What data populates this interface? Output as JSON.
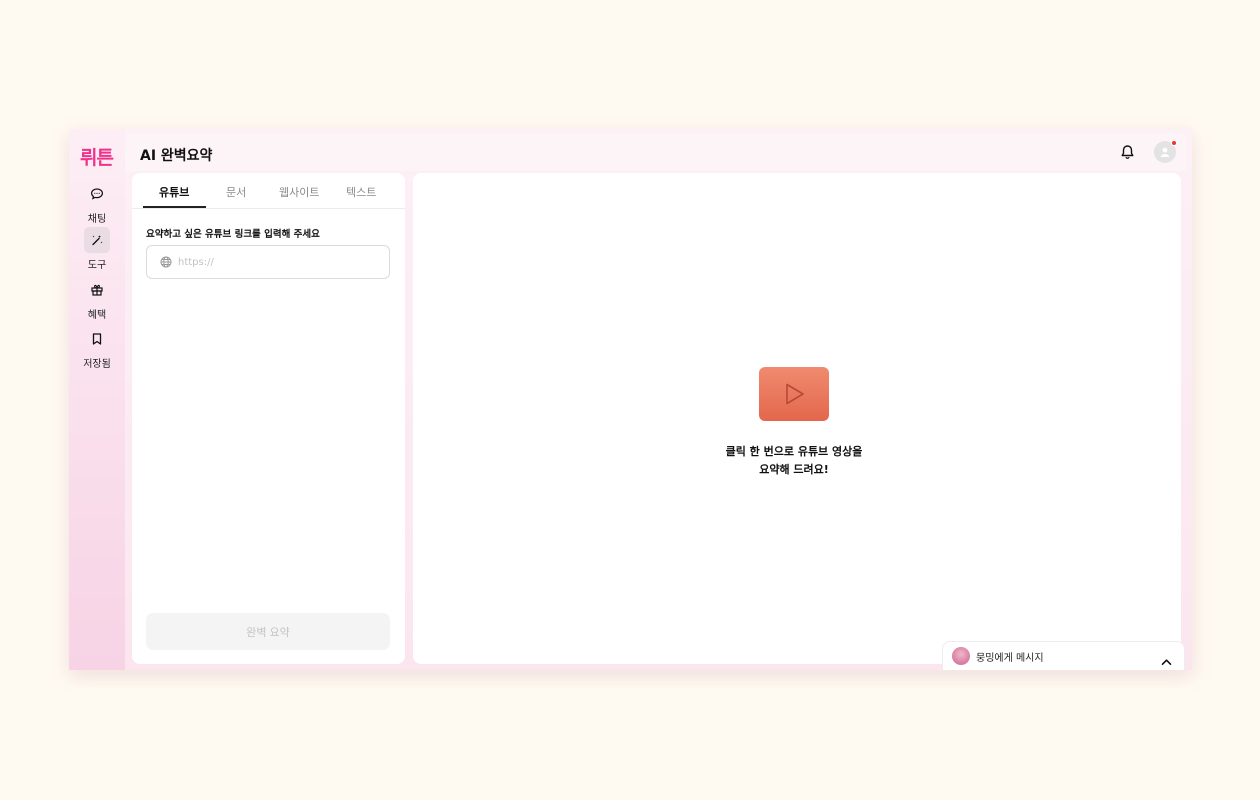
{
  "rail": {
    "logo": "뤼튼",
    "items": [
      {
        "label": "채팅",
        "icon": "chat-bubble-icon"
      },
      {
        "label": "도구",
        "icon": "magic-wand-icon",
        "active": true
      },
      {
        "label": "혜택",
        "icon": "gift-icon"
      },
      {
        "label": "저장됨",
        "icon": "bookmark-icon"
      }
    ]
  },
  "header": {
    "title": "AI 완벽요약",
    "notification_icon": "bell-icon",
    "avatar_icon": "user-avatar-icon"
  },
  "left_panel": {
    "tabs": [
      {
        "label": "유튜브",
        "active": true
      },
      {
        "label": "문서"
      },
      {
        "label": "웹사이트"
      },
      {
        "label": "텍스트"
      }
    ],
    "prompt_label": "요약하고 싶은 유튜브 링크를 입력해 주세요",
    "url_input": {
      "placeholder": "https://",
      "value": "",
      "icon": "globe-icon"
    },
    "submit_label": "완벽 요약"
  },
  "right_panel": {
    "empty_icon": "play-icon",
    "empty_line1": "클릭 한 번으로 유튜브 영상을",
    "empty_line2": "요약해 드려요!"
  },
  "chat_widget": {
    "label": "뭉밍에게 메시지",
    "icon": "chevron-up-icon"
  },
  "colors": {
    "brand": "#f0328c",
    "accent": "#e4674c",
    "notification": "#e3382f"
  }
}
